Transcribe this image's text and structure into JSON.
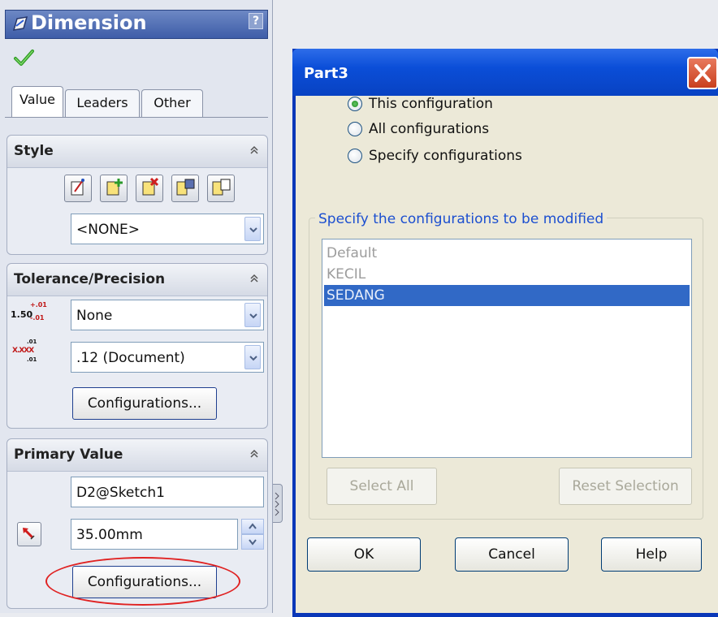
{
  "panel": {
    "title": "Dimension",
    "help": "?",
    "tabs": [
      "Value",
      "Leaders",
      "Other"
    ],
    "style_group": {
      "title": "Style",
      "style_select": "<NONE>"
    },
    "tolerance_group": {
      "title": "Tolerance/Precision",
      "tolerance_type": "None",
      "precision": ".12 (Document)",
      "tolerance_icon_main": "1.50",
      "tolerance_icon_plus": "+.01",
      "tolerance_icon_minus": "-.01",
      "precision_icon_top": ".01",
      "precision_icon_main": "X.XXX",
      "precision_icon_bottom": ".01",
      "configurations_button": "Configurations..."
    },
    "primary_value_group": {
      "title": "Primary Value",
      "name": "D2@Sketch1",
      "value": "35.00mm",
      "configurations_button": "Configurations..."
    }
  },
  "dialog": {
    "title": "Part3",
    "radio_options": [
      {
        "label": "This configuration",
        "checked": true
      },
      {
        "label": "All configurations",
        "checked": false
      },
      {
        "label": "Specify configurations",
        "checked": false
      }
    ],
    "group_label": "Specify the configurations to be modified",
    "configs": [
      {
        "label": "Default",
        "selected": false
      },
      {
        "label": "KECIL",
        "selected": false
      },
      {
        "label": "SEDANG",
        "selected": true
      }
    ],
    "select_all": "Select All",
    "reset_selection": "Reset Selection",
    "ok": "OK",
    "cancel": "Cancel",
    "help": "Help"
  },
  "colors": {
    "xp_title_blue": "#0b4ed8",
    "selection_blue": "#3169c6",
    "annotation_red": "#e02222"
  }
}
